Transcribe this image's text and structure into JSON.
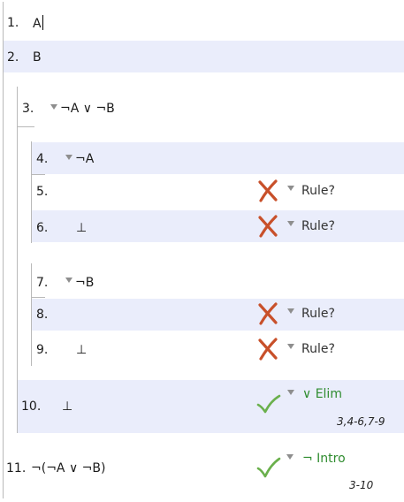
{
  "lines": [
    {
      "num": "1.",
      "formula": "A"
    },
    {
      "num": "2.",
      "formula": "B"
    },
    {
      "num": "3.",
      "formula": "¬A ∨ ¬B"
    },
    {
      "num": "4.",
      "formula": "¬A"
    },
    {
      "num": "5.",
      "formula": "",
      "rule": "Rule?"
    },
    {
      "num": "6.",
      "formula": "⊥",
      "rule": "Rule?"
    },
    {
      "num": "7.",
      "formula": "¬B"
    },
    {
      "num": "8.",
      "formula": "",
      "rule": "Rule?"
    },
    {
      "num": "9.",
      "formula": "⊥",
      "rule": "Rule?"
    },
    {
      "num": "10.",
      "formula": "⊥",
      "rule": "∨ Elim",
      "refs": "3,4-6,7-9"
    },
    {
      "num": "11.",
      "formula": "¬(¬A ∨ ¬B)",
      "rule": "¬ Intro",
      "refs": "3-10"
    }
  ],
  "icons": {
    "valid": "check-mark-icon",
    "invalid": "cross-mark-icon",
    "dropdown": "dropdown-triangle-icon",
    "error_color": "#c8502a",
    "valid_color": "#6ab04c"
  }
}
